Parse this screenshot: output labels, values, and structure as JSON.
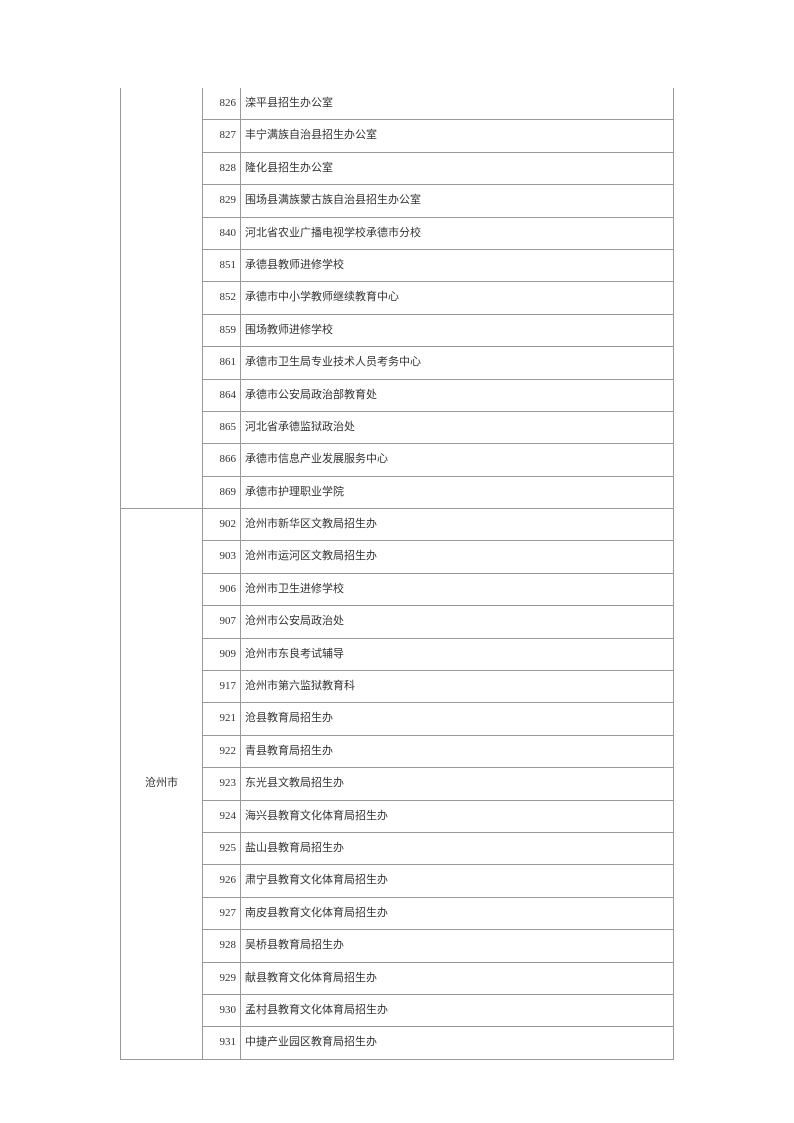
{
  "groups": [
    {
      "region": "",
      "emptyRegion": true,
      "rows": [
        {
          "code": "826",
          "name": "滦平县招生办公室"
        },
        {
          "code": "827",
          "name": "丰宁满族自治县招生办公室"
        },
        {
          "code": "828",
          "name": "隆化县招生办公室"
        },
        {
          "code": "829",
          "name": "围场县满族蒙古族自治县招生办公室"
        },
        {
          "code": "840",
          "name": "河北省农业广播电视学校承德市分校"
        },
        {
          "code": "851",
          "name": "承德县教师进修学校"
        },
        {
          "code": "852",
          "name": "承德市中小学教师继续教育中心"
        },
        {
          "code": "859",
          "name": "围场教师进修学校"
        },
        {
          "code": "861",
          "name": "承德市卫生局专业技术人员考务中心"
        },
        {
          "code": "864",
          "name": "承德市公安局政治部教育处"
        },
        {
          "code": "865",
          "name": "河北省承德监狱政治处"
        },
        {
          "code": "866",
          "name": "承德市信息产业发展服务中心"
        },
        {
          "code": "869",
          "name": "承德市护理职业学院"
        }
      ]
    },
    {
      "region": "沧州市",
      "emptyRegion": false,
      "rows": [
        {
          "code": "902",
          "name": "沧州市新华区文教局招生办"
        },
        {
          "code": "903",
          "name": "沧州市运河区文教局招生办"
        },
        {
          "code": "906",
          "name": "沧州市卫生进修学校"
        },
        {
          "code": "907",
          "name": "沧州市公安局政治处"
        },
        {
          "code": "909",
          "name": "沧州市东良考试辅导"
        },
        {
          "code": "917",
          "name": "沧州市第六监狱教育科"
        },
        {
          "code": "921",
          "name": "沧县教育局招生办"
        },
        {
          "code": "922",
          "name": "青县教育局招生办"
        },
        {
          "code": "923",
          "name": "东光县文教局招生办"
        },
        {
          "code": "924",
          "name": "海兴县教育文化体育局招生办"
        },
        {
          "code": "925",
          "name": "盐山县教育局招生办"
        },
        {
          "code": "926",
          "name": "肃宁县教育文化体育局招生办"
        },
        {
          "code": "927",
          "name": "南皮县教育文化体育局招生办"
        },
        {
          "code": "928",
          "name": "吴桥县教育局招生办"
        },
        {
          "code": "929",
          "name": "献县教育文化体育局招生办"
        },
        {
          "code": "930",
          "name": "孟村县教育文化体育局招生办"
        },
        {
          "code": "931",
          "name": "中捷产业园区教育局招生办"
        }
      ]
    }
  ]
}
